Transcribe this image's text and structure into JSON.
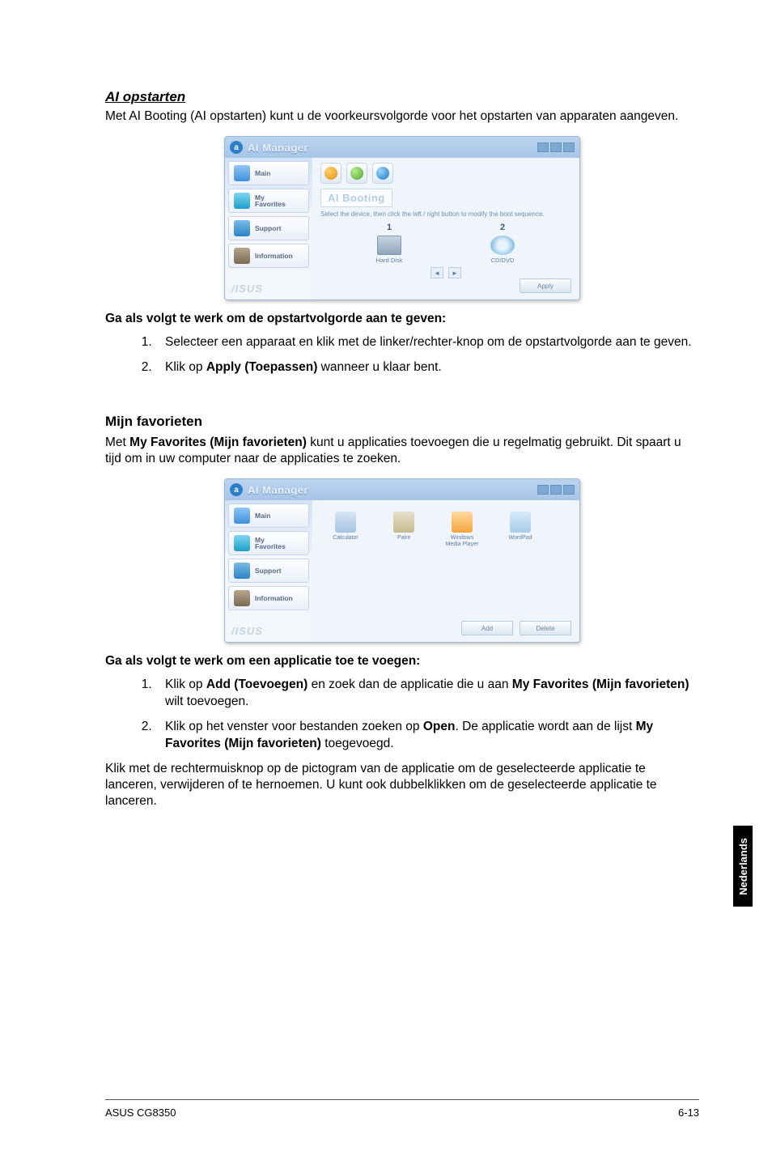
{
  "sections": {
    "ai_opstarten": {
      "title": "AI opstarten",
      "intro": "Met AI Booting (AI opstarten) kunt u de voorkeursvolgorde voor het opstarten van apparaten aangeven.",
      "instr_title": "Ga als volgt te werk om de opstartvolgorde aan te geven:",
      "steps": [
        {
          "pre": "Selecteer een apparaat en klik met de linker/rechter-knop om de opstartvolgorde aan te geven."
        },
        {
          "pre": "Klik op ",
          "bold": "Apply (Toepassen)",
          "post": " wanneer u klaar bent."
        }
      ]
    },
    "mijn_fav": {
      "title": "Mijn favorieten",
      "intro_pre": "Met ",
      "intro_bold": "My Favorites (Mijn favorieten)",
      "intro_post": " kunt u applicaties toevoegen die u regelmatig gebruikt. Dit spaart u tijd om in uw computer naar de applicaties te zoeken.",
      "instr_title": "Ga als volgt te werk om een applicatie toe te voegen:",
      "steps": [
        {
          "pre": "Klik op ",
          "b1": "Add (Toevoegen)",
          "mid": " en zoek dan de applicatie die u aan ",
          "b2": "My Favorites (Mijn favorieten)",
          "post": " wilt toevoegen."
        },
        {
          "pre": "Klik op het venster voor bestanden zoeken op ",
          "b1": "Open",
          "mid": ". De applicatie wordt aan de lijst ",
          "b2": "My Favorites (Mijn favorieten)",
          "post": " toegevoegd."
        }
      ],
      "outro": "Klik met de rechtermuisknop op de pictogram van de applicatie om de geselecteerde applicatie te lanceren, verwijderen of te hernoemen. U kunt ook dubbelklikken om de geselecteerde applicatie te lanceren."
    }
  },
  "win1": {
    "title": "AI Manager",
    "side": {
      "main": "Main",
      "fav_l1": "My",
      "fav_l2": "Favorites",
      "support": "Support",
      "info": "Information"
    },
    "brand": "/ISUS",
    "panel_title": "AI Booting",
    "hint": "Select the device, then click the left / right button to modify the boot sequence.",
    "dev1_num": "1",
    "dev1_label": "Hard Disk",
    "dev2_num": "2",
    "dev2_label": "CD/DVD",
    "apply": "Apply"
  },
  "win2": {
    "title": "AI Manager",
    "side": {
      "main": "Main",
      "fav_l1": "My",
      "fav_l2": "Favorites",
      "support": "Support",
      "info": "Information"
    },
    "brand": "/ISUS",
    "fav_items": {
      "a": "Calculator",
      "b": "Paint",
      "c_l1": "Windows",
      "c_l2": "Media Player",
      "d": "WordPad"
    },
    "add": "Add",
    "delete": "Delete"
  },
  "lang_tab": "Nederlands",
  "footer": {
    "left": "ASUS CG8350",
    "right": "6-13"
  }
}
